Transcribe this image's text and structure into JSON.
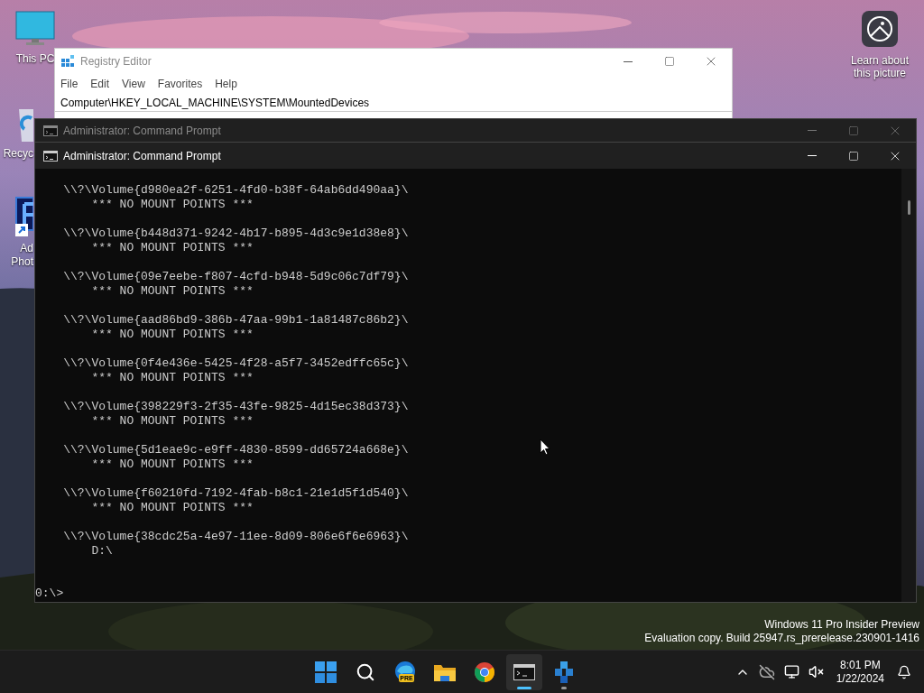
{
  "desktop_icons": [
    {
      "kind": "pc",
      "lines": [
        "This PC"
      ]
    },
    {
      "kind": "recycle",
      "lines": [
        "Recyc"
      ]
    },
    {
      "kind": "photoshop",
      "lines": [
        "Ad",
        "Phot"
      ]
    }
  ],
  "learn_icon": {
    "lines": [
      "Learn about",
      "this picture"
    ]
  },
  "registry_editor": {
    "title": "Registry Editor",
    "menu": [
      "File",
      "Edit",
      "View",
      "Favorites",
      "Help"
    ],
    "address": "Computer\\HKEY_LOCAL_MACHINE\\SYSTEM\\MountedDevices"
  },
  "back_window": {
    "title": "Administrator: Command Prompt"
  },
  "front_window": {
    "title": "Administrator: Command Prompt"
  },
  "console": {
    "entries": [
      {
        "volume": "\\\\?\\Volume{d980ea2f-6251-4fd0-b38f-64ab6dd490aa}\\",
        "mount": "*** NO MOUNT POINTS ***"
      },
      {
        "volume": "\\\\?\\Volume{b448d371-9242-4b17-b895-4d3c9e1d38e8}\\",
        "mount": "*** NO MOUNT POINTS ***"
      },
      {
        "volume": "\\\\?\\Volume{09e7eebe-f807-4cfd-b948-5d9c06c7df79}\\",
        "mount": "*** NO MOUNT POINTS ***"
      },
      {
        "volume": "\\\\?\\Volume{aad86bd9-386b-47aa-99b1-1a81487c86b2}\\",
        "mount": "*** NO MOUNT POINTS ***"
      },
      {
        "volume": "\\\\?\\Volume{0f4e436e-5425-4f28-a5f7-3452edffc65c}\\",
        "mount": "*** NO MOUNT POINTS ***"
      },
      {
        "volume": "\\\\?\\Volume{398229f3-2f35-43fe-9825-4d15ec38d373}\\",
        "mount": "*** NO MOUNT POINTS ***"
      },
      {
        "volume": "\\\\?\\Volume{5d1eae9c-e9ff-4830-8599-dd65724a668e}\\",
        "mount": "*** NO MOUNT POINTS ***"
      },
      {
        "volume": "\\\\?\\Volume{f60210fd-7192-4fab-b8c1-21e1d5f1d540}\\",
        "mount": "*** NO MOUNT POINTS ***"
      },
      {
        "volume": "\\\\?\\Volume{38cdc25a-4e97-11ee-8d09-806e6f6e6963}\\",
        "mount": "D:\\"
      }
    ],
    "prompt": "0:\\>"
  },
  "watermark": [
    "Windows 11 Pro Insider Preview",
    "Evaluation copy. Build 25947.rs_prerelease.230901-1416"
  ],
  "taskbar": {
    "apps": [
      {
        "kind": "start",
        "active": false,
        "running": false
      },
      {
        "kind": "search",
        "active": false,
        "running": false
      },
      {
        "kind": "edge",
        "badge": "PRE",
        "active": false,
        "running": false
      },
      {
        "kind": "folder",
        "active": false,
        "running": false
      },
      {
        "kind": "chrome",
        "active": false,
        "running": false
      },
      {
        "kind": "terminal",
        "active": true,
        "running": true
      },
      {
        "kind": "cubes",
        "active": false,
        "running": true
      }
    ],
    "time": "8:01 PM",
    "date": "1/22/2024"
  }
}
